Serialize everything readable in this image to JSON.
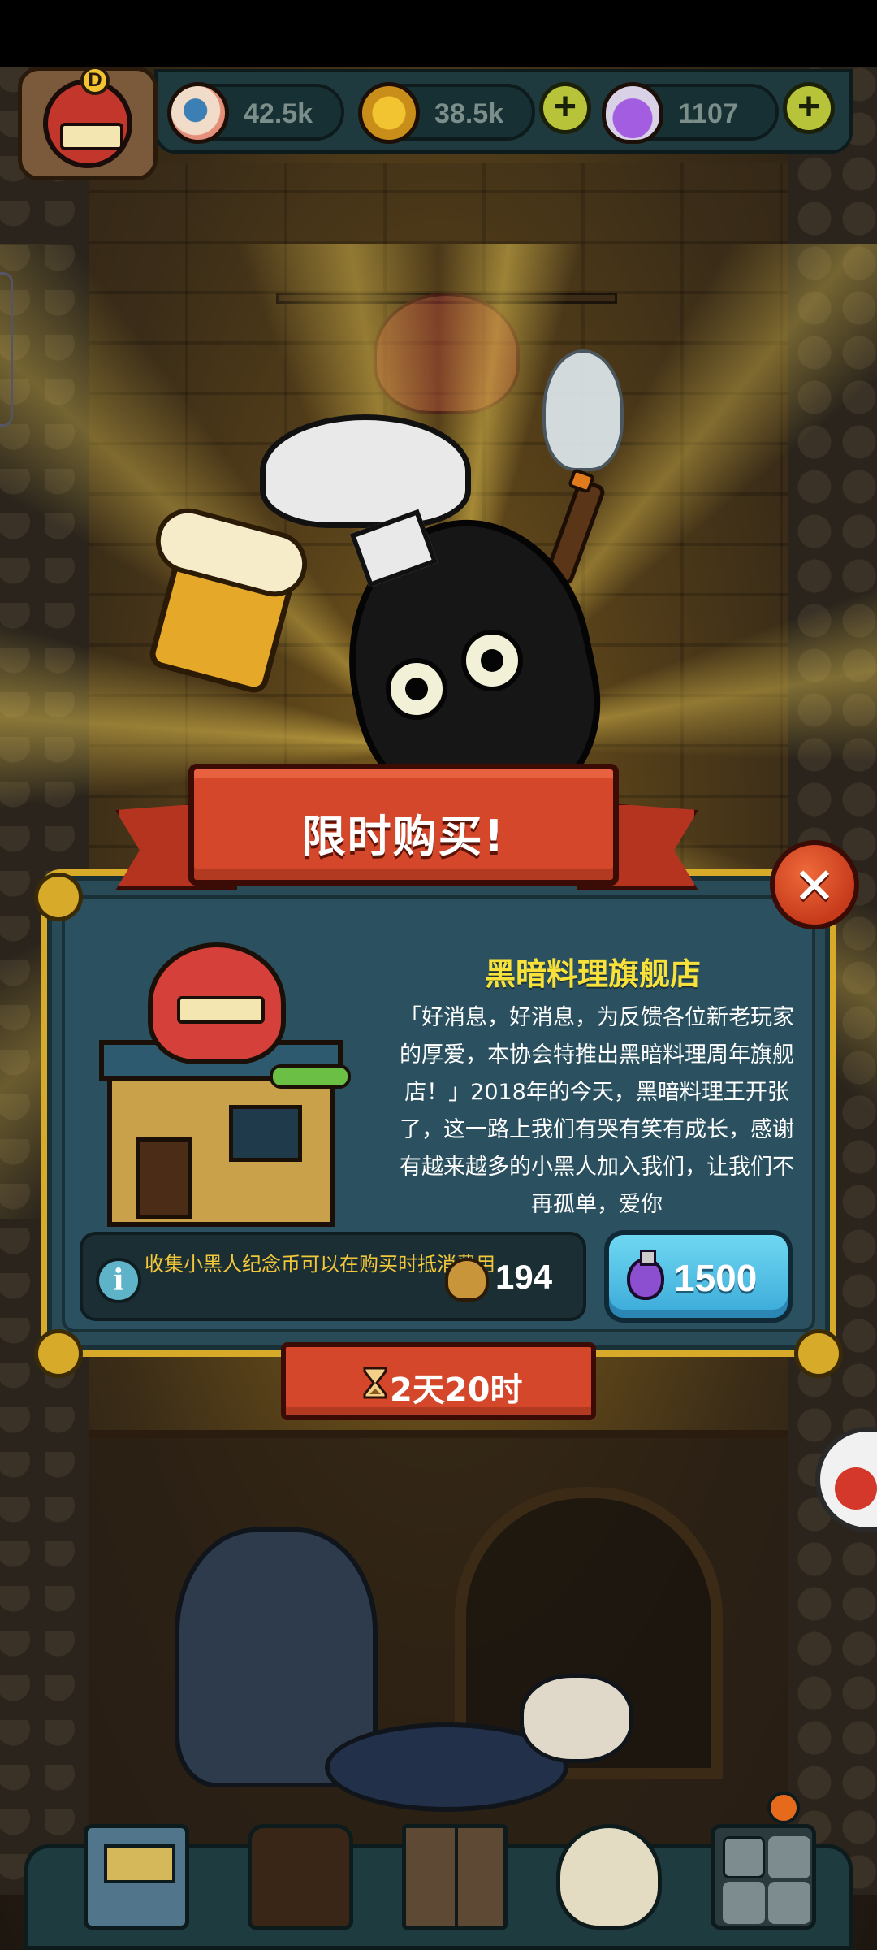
{
  "resources": {
    "eyes": "42.5k",
    "coins": "38.5k",
    "potions": "1107",
    "plus_symbol": "+"
  },
  "player": {
    "rank_letter": "D"
  },
  "offer": {
    "banner_title": "限时购买!",
    "close_symbol": "✕",
    "shop_name": "黑暗料理旗舰店",
    "description": "「好消息，好消息，为反馈各位新老玩家的厚爱，本协会特推出黑暗料理周年旗舰店！」2018年的今天，黑暗料理王开张了，这一路上我们有哭有笑有成长，感谢有越来越多的小黑人加入我们，让我们不再孤单，爱你",
    "info_icon": "i",
    "info_text": "收集小黑人纪念币可以在购买时抵消费用",
    "token_count": "194",
    "price": "1500",
    "timer": "2天20时"
  },
  "colors": {
    "banner_red": "#d4472a",
    "panel_teal": "#284b57",
    "panel_gold": "#d7aa2a",
    "title_yellow": "#f7e13a",
    "buy_blue": "#4fc0e6"
  },
  "icons": [
    "eye-icon",
    "coin-icon",
    "potion-icon",
    "plus-icon",
    "close-icon",
    "info-icon",
    "hourglass-icon",
    "token-icon"
  ]
}
